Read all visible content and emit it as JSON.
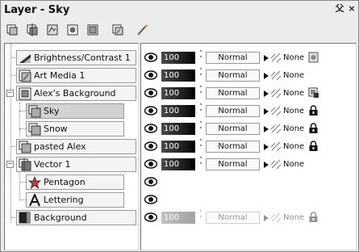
{
  "window": {
    "title": "Layer - Sky",
    "pin_label": "⽗",
    "close_label": "×"
  },
  "toolbar": {
    "icons": [
      "new-raster-layer-icon",
      "new-vector-layer-icon",
      "new-adjustment-layer-icon",
      "new-mask-layer-icon",
      "new-group-icon",
      "new-art-media-layer-icon",
      "brush-variance-icon"
    ]
  },
  "layers": [
    {
      "name": "Brightness/Contrast 1",
      "opacity": "100",
      "blend": "Normal",
      "link": "None",
      "depth": 0,
      "icon": "adjustment-layer-icon",
      "lock_icon": "mask-icon",
      "selected": false
    },
    {
      "name": "Art Media 1",
      "opacity": "100",
      "blend": "Normal",
      "link": "None",
      "depth": 0,
      "icon": "art-media-layer-icon",
      "lock_icon": "",
      "selected": false
    },
    {
      "name": "Alex's Background",
      "opacity": "100",
      "blend": "Normal",
      "link": "None",
      "depth": 0,
      "icon": "group-layer-icon",
      "lock_icon": "group-lock-icon",
      "selected": false
    },
    {
      "name": "Sky",
      "opacity": "100",
      "blend": "Normal",
      "link": "None",
      "depth": 1,
      "icon": "raster-layer-icon",
      "lock_icon": "lock-icon",
      "selected": true
    },
    {
      "name": "Snow",
      "opacity": "100",
      "blend": "Normal",
      "link": "None",
      "depth": 1,
      "icon": "raster-layer-icon",
      "lock_icon": "lock-icon",
      "selected": false
    },
    {
      "name": "pasted Alex",
      "opacity": "100",
      "blend": "Normal",
      "link": "None",
      "depth": 0,
      "icon": "raster-layer-icon",
      "lock_icon": "lock-icon",
      "selected": false
    },
    {
      "name": "Vector 1",
      "opacity": "100",
      "blend": "Normal",
      "link": "None",
      "depth": 0,
      "icon": "vector-layer-icon",
      "lock_icon": "",
      "selected": false
    },
    {
      "name": "Pentagon",
      "opacity": "",
      "blend": "",
      "link": "",
      "depth": 1,
      "icon": "star-shape-icon",
      "lock_icon": "",
      "selected": false
    },
    {
      "name": "Lettering",
      "opacity": "",
      "blend": "",
      "link": "",
      "depth": 1,
      "icon": "text-layer-icon",
      "lock_icon": "",
      "selected": false
    },
    {
      "name": "Background",
      "opacity": "100",
      "blend": "Normal",
      "link": "None",
      "depth": 0,
      "icon": "background-layer-icon",
      "lock_icon": "lock-icon",
      "selected": false,
      "faded": true
    }
  ]
}
